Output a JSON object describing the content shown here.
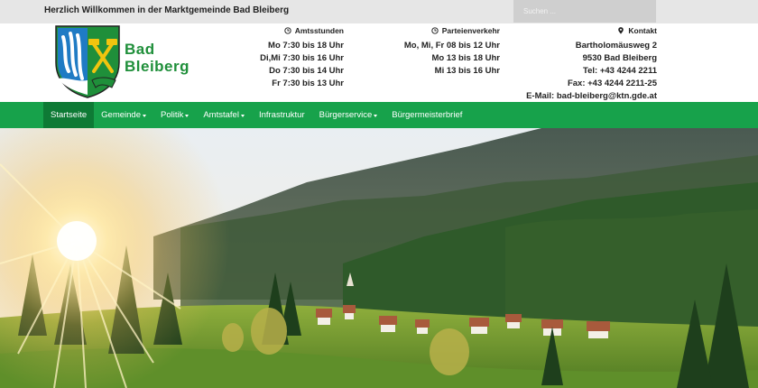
{
  "topbar": {
    "welcome": "Herzlich Willkommen in der Marktgemeinde Bad Bleiberg",
    "search_placeholder": "Suchen ..."
  },
  "brand": {
    "line1": "Bad",
    "line2": "Bleiberg"
  },
  "amtsstunden": {
    "title": "Amtsstunden",
    "icon": "clock-icon",
    "lines": [
      "Mo 7:30 bis 18 Uhr",
      "Di,Mi 7:30 bis 16 Uhr",
      "Do 7:30 bis 14 Uhr",
      "Fr 7:30 bis 13 Uhr"
    ]
  },
  "parteienverkehr": {
    "title": "Parteienverkehr",
    "icon": "clock-icon",
    "lines": [
      "Mo, Mi, Fr 08 bis 12 Uhr",
      "Mo 13 bis 18 Uhr",
      "Mi 13 bis 16 Uhr"
    ]
  },
  "kontakt": {
    "title": "Kontakt",
    "icon": "map-marker-icon",
    "lines": [
      "Bartholomäusweg 2",
      "9530 Bad Bleiberg",
      "Tel: +43 4244 2211",
      "Fax: +43 4244 2211-25",
      "E-Mail: bad-bleiberg@ktn.gde.at"
    ]
  },
  "nav": {
    "items": [
      {
        "label": "Startseite",
        "dropdown": false,
        "active": true
      },
      {
        "label": "Gemeinde",
        "dropdown": true,
        "active": false
      },
      {
        "label": "Politik",
        "dropdown": true,
        "active": false
      },
      {
        "label": "Amtstafel",
        "dropdown": true,
        "active": false
      },
      {
        "label": "Infrastruktur",
        "dropdown": false,
        "active": false
      },
      {
        "label": "Bürgerservice",
        "dropdown": true,
        "active": false
      },
      {
        "label": "Bürgermeisterbrief",
        "dropdown": false,
        "active": false
      }
    ]
  },
  "colors": {
    "topbar": "#e6e6e6",
    "brand_green": "#1f8f3a",
    "nav_green": "#17a24b",
    "nav_active": "#0e7a35"
  }
}
